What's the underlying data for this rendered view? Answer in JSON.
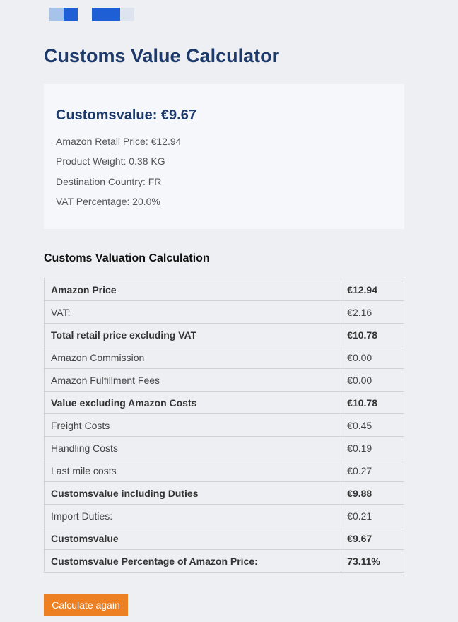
{
  "page": {
    "title": "Customs Value Calculator"
  },
  "summary": {
    "title": "Customsvalue: €9.67",
    "lines": [
      "Amazon Retail Price: €12.94",
      "Product Weight: 0.38 KG",
      "Destination Country: FR",
      "VAT Percentage: 20.0%"
    ]
  },
  "calculation": {
    "title": "Customs Valuation Calculation",
    "rows": [
      {
        "label": "Amazon Price",
        "value": "€12.94",
        "bold": true
      },
      {
        "label": "VAT:",
        "value": "€2.16",
        "bold": false
      },
      {
        "label": "Total retail price excluding VAT",
        "value": "€10.78",
        "bold": true
      },
      {
        "label": "Amazon Commission",
        "value": "€0.00",
        "bold": false
      },
      {
        "label": "Amazon Fulfillment Fees",
        "value": "€0.00",
        "bold": false
      },
      {
        "label": "Value excluding Amazon Costs",
        "value": "€10.78",
        "bold": true
      },
      {
        "label": "Freight Costs",
        "value": "€0.45",
        "bold": false
      },
      {
        "label": "Handling Costs",
        "value": "€0.19",
        "bold": false
      },
      {
        "label": "Last mile costs",
        "value": "€0.27",
        "bold": false
      },
      {
        "label": "Customsvalue including Duties",
        "value": "€9.88",
        "bold": true
      },
      {
        "label": "Import Duties:",
        "value": "€0.21",
        "bold": false
      },
      {
        "label": "Customsvalue",
        "value": "€9.67",
        "bold": true
      },
      {
        "label": "Customsvalue Percentage of Amazon Price:",
        "value": "73.11%",
        "bold": true
      }
    ]
  },
  "actions": {
    "calculate_again_label": "Calculate again"
  },
  "colors": {
    "background": "#eeeff2",
    "title": "#1d3a6b",
    "button": "#ec8023",
    "logo_blue": "#1f5fd6"
  }
}
